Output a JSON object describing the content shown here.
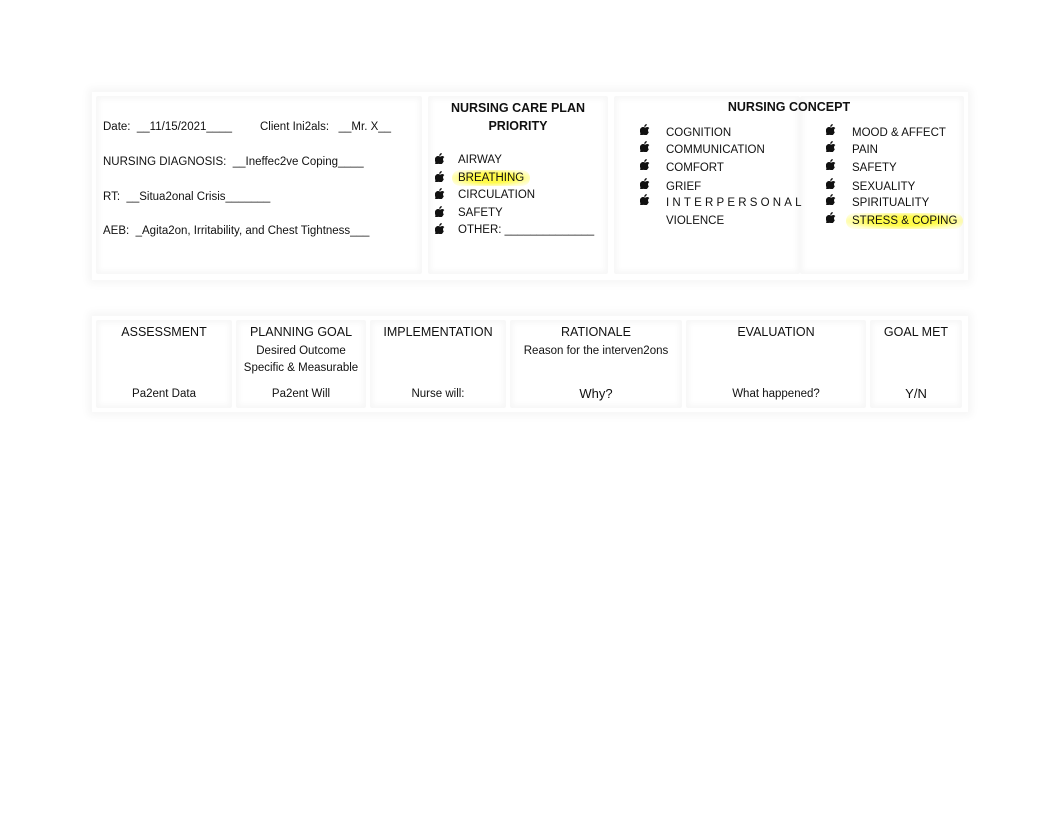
{
  "header_section": {
    "date_label": "Date:",
    "date_value": "__11/15/2021____",
    "initials_label": "Client Ini2als:",
    "initials_value": "__Mr. X__",
    "diagnosis_label": "NURSING DIAGNOSIS:",
    "diagnosis_value": "__Ineffec2ve Coping____",
    "rt_label": "RT:",
    "rt_value": "__Situa2onal Crisis_______",
    "aeb_label": "AEB:",
    "aeb_value": "_Agita2on, Irritability, and Chest Tightness___"
  },
  "priority": {
    "title_line1": "NURSING CARE PLAN",
    "title_line2": "PRIORITY",
    "items": [
      {
        "label": "AIRWAY",
        "highlighted": false
      },
      {
        "label": "BREATHING",
        "highlighted": true
      },
      {
        "label": "CIRCULATION",
        "highlighted": false
      },
      {
        "label": "SAFETY",
        "highlighted": false
      },
      {
        "label": "OTHER:  ______________",
        "highlighted": false
      }
    ],
    "bullet_icon": "apple-icon"
  },
  "concept": {
    "title": "NURSING CONCEPT",
    "left_items": [
      {
        "label": "COGNITION"
      },
      {
        "label": "COMMUNICATION"
      },
      {
        "label": "COMFORT"
      },
      {
        "label": "GRIEF"
      },
      {
        "label": "INTERPERSONAL"
      },
      {
        "label": "VIOLENCE"
      }
    ],
    "right_items": [
      {
        "label": "MOOD & AFFECT",
        "highlighted": false
      },
      {
        "label": "PAIN",
        "highlighted": false
      },
      {
        "label": "SAFETY",
        "highlighted": false
      },
      {
        "label": "SEXUALITY",
        "highlighted": false
      },
      {
        "label": "SPIRITUALITY",
        "highlighted": false
      },
      {
        "label": "STRESS & COPING",
        "highlighted": true
      }
    ],
    "highlight_color": "#fff82a"
  },
  "table": {
    "columns": [
      {
        "header": "ASSESSMENT",
        "sub": [],
        "prompt": "Pa2ent Data"
      },
      {
        "header": "PLANNING GOAL",
        "sub": [
          "Desired Outcome",
          "Specific & Measurable"
        ],
        "prompt": "Pa2ent Will"
      },
      {
        "header": "IMPLEMENTATION",
        "sub": [],
        "prompt": "Nurse will:"
      },
      {
        "header": "RATIONALE",
        "sub": [
          "Reason for the interven2ons"
        ],
        "prompt": "Why?"
      },
      {
        "header": "EVALUATION",
        "sub": [],
        "prompt": "What happened?"
      },
      {
        "header": "GOAL MET",
        "sub": [],
        "prompt": "Y/N"
      }
    ]
  }
}
